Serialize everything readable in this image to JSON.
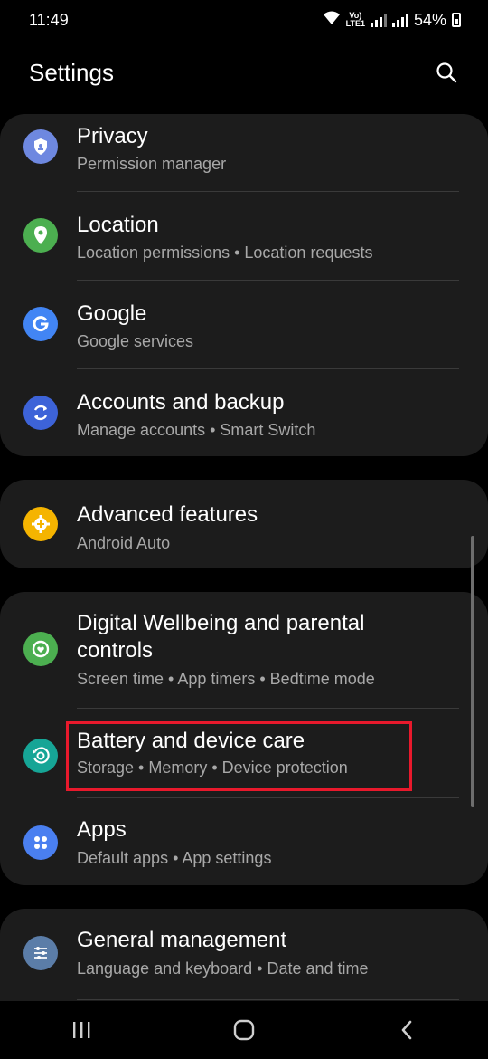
{
  "status": {
    "time": "11:49",
    "lte_top": "Vo)",
    "lte_bottom": "LTE1",
    "battery": "54%"
  },
  "header": {
    "title": "Settings"
  },
  "cards": [
    {
      "items": [
        {
          "title": "Privacy",
          "subtitle": "Permission manager",
          "icon": "privacy-shield-icon",
          "icon_color": "#6e88e0"
        },
        {
          "title": "Location",
          "subtitle": "Location permissions  •  Location requests",
          "icon": "location-pin-icon",
          "icon_color": "#4caf50"
        },
        {
          "title": "Google",
          "subtitle": "Google services",
          "icon": "google-icon",
          "icon_color": "#4285f4"
        },
        {
          "title": "Accounts and backup",
          "subtitle": "Manage accounts  •  Smart Switch",
          "icon": "sync-icon",
          "icon_color": "#3d63d8"
        }
      ]
    },
    {
      "items": [
        {
          "title": "Advanced features",
          "subtitle": "Android Auto",
          "icon": "gear-plus-icon",
          "icon_color": "#f5b400"
        }
      ]
    },
    {
      "items": [
        {
          "title_line1": "Digital Wellbeing and parental",
          "title_line2": "controls",
          "subtitle": "Screen time  •  App timers  •  Bedtime mode",
          "icon": "wellbeing-icon",
          "icon_color": "#4caf50"
        },
        {
          "title": "Battery and device care",
          "subtitle": "Storage  •  Memory  •  Device protection",
          "icon": "device-care-icon",
          "icon_color": "#16a596"
        },
        {
          "title": "Apps",
          "subtitle": "Default apps  •  App settings",
          "icon": "apps-grid-icon",
          "icon_color": "#4a7ff0"
        }
      ]
    },
    {
      "items": [
        {
          "title": "General management",
          "subtitle": "Language and keyboard  •  Date and time",
          "icon": "sliders-icon",
          "icon_color": "#5b7da8"
        }
      ]
    }
  ],
  "colors": {
    "background": "#000000",
    "card": "#1c1c1c",
    "highlight": "#e8192c",
    "subtitle": "#a8a8a8"
  }
}
